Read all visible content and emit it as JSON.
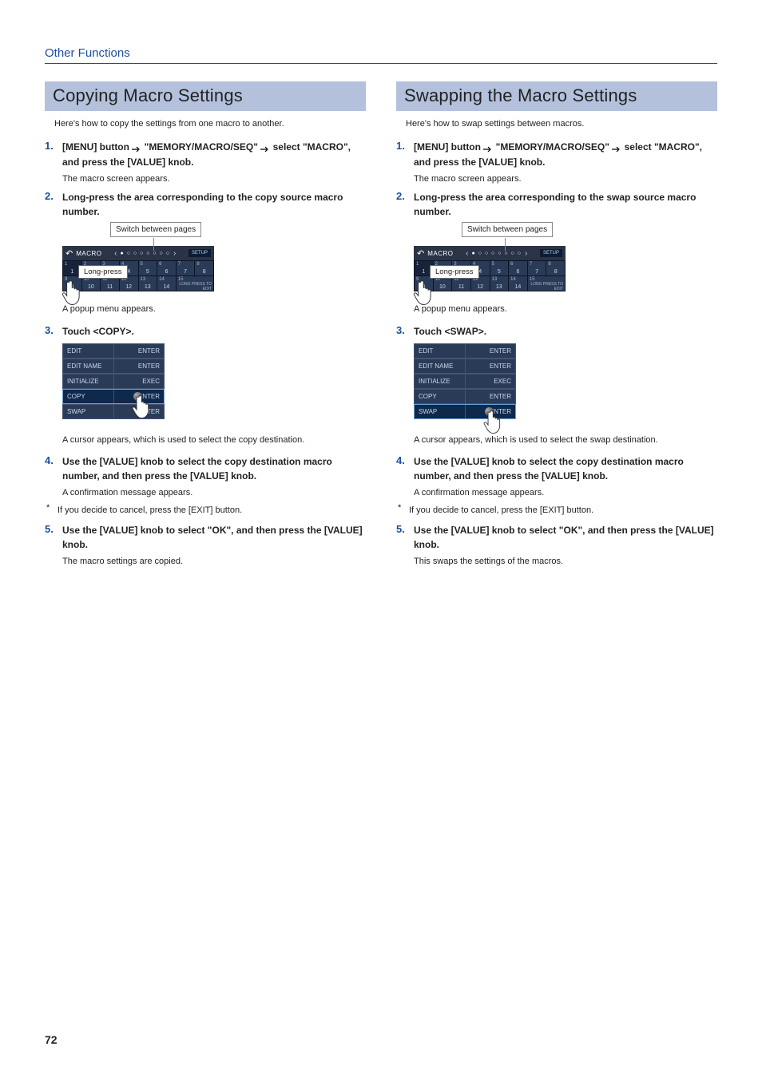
{
  "breadcrumb": "Other Functions",
  "pageNumber": "72",
  "shared": {
    "callout": "Switch between pages",
    "longPress": "Long-press",
    "popup": {
      "rows": [
        {
          "l": "EDIT",
          "r": "ENTER"
        },
        {
          "l": "EDIT NAME",
          "r": "ENTER"
        },
        {
          "l": "INITIALIZE",
          "r": "EXEC"
        },
        {
          "l": "COPY",
          "r": "ENTER"
        },
        {
          "l": "SWAP",
          "r": "ENTER"
        }
      ]
    },
    "macHeader": {
      "title": "MACRO",
      "setup": "SETUP"
    },
    "macFoot": "LONG PRESS TO EDIT"
  },
  "left": {
    "title": "Copying Macro Settings",
    "intro": "Here's how to copy the settings from one macro to another.",
    "steps": {
      "s1": {
        "num": "1.",
        "pre": "[MENU] button ",
        "mid": " \"MEMORY/MACRO/SEQ\" ",
        "post": " select \"MACRO\", and press the [VALUE] knob.",
        "sub": "The macro screen appears."
      },
      "s2": {
        "num": "2.",
        "title": "Long-press the area corresponding to the copy source macro number.",
        "sub": "A popup menu appears."
      },
      "s3": {
        "num": "3.",
        "title": "Touch <COPY>.",
        "sub": "A cursor appears, which is used to select the copy destination."
      },
      "s4": {
        "num": "4.",
        "title": "Use the [VALUE] knob to select the copy destination macro number, and then press the [VALUE] knob.",
        "sub": "A confirmation message appears.",
        "note": "If you decide to cancel, press the [EXIT] button."
      },
      "s5": {
        "num": "5.",
        "title": "Use the [VALUE] knob to select \"OK\", and then press the [VALUE] knob.",
        "sub": "The macro settings are copied."
      }
    },
    "popupHighlight": 3
  },
  "right": {
    "title": "Swapping the Macro Settings",
    "intro": "Here's how to swap settings between macros.",
    "steps": {
      "s1": {
        "num": "1.",
        "pre": "[MENU] button ",
        "mid": " \"MEMORY/MACRO/SEQ\" ",
        "post": " select \"MACRO\", and press the [VALUE] knob.",
        "sub": "The macro screen appears."
      },
      "s2": {
        "num": "2.",
        "title": "Long-press the area corresponding to the swap source macro number.",
        "sub": "A popup menu appears."
      },
      "s3": {
        "num": "3.",
        "title": "Touch <SWAP>.",
        "sub": "A cursor appears, which is used to select the swap destination."
      },
      "s4": {
        "num": "4.",
        "title": "Use the [VALUE] knob to select the copy destination macro number, and then press the [VALUE] knob.",
        "sub": "A confirmation message appears.",
        "note": "If you decide to cancel, press the [EXIT] button."
      },
      "s5": {
        "num": "5.",
        "title": "Use the [VALUE] knob to select \"OK\", and then press the [VALUE] knob.",
        "sub": "This swaps the settings of the macros."
      }
    },
    "popupHighlight": 4
  }
}
